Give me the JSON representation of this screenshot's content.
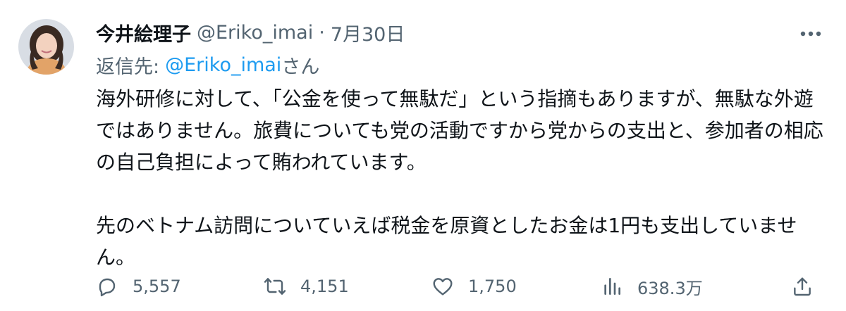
{
  "author": {
    "display_name": "今井絵理子",
    "handle": "@Eriko_imai",
    "separator": "·",
    "date": "7月30日"
  },
  "reply": {
    "prefix": "返信先:",
    "mention": "@Eriko_imai",
    "suffix": "さん"
  },
  "body": {
    "paragraph1": "海外研修に対して、「公金を使って無駄だ」という指摘もありますが、無駄な外遊ではありません。旅費についても党の活動ですから党からの支出と、参加者の相応の自己負担によって賄われています。",
    "paragraph2": "先のベトナム訪問についていえば税金を原資としたお金は1円も支出していません。"
  },
  "actions": {
    "reply_count": "5,557",
    "retweet_count": "4,151",
    "like_count": "1,750",
    "views_count": "638.3万"
  },
  "icons": {
    "more": "more-icon",
    "reply": "reply-icon",
    "retweet": "retweet-icon",
    "like": "heart-icon",
    "views": "views-icon",
    "share": "share-icon"
  },
  "colors": {
    "text": "#0f1419",
    "secondary": "#536471",
    "link": "#1d9bf0",
    "background": "#ffffff"
  }
}
